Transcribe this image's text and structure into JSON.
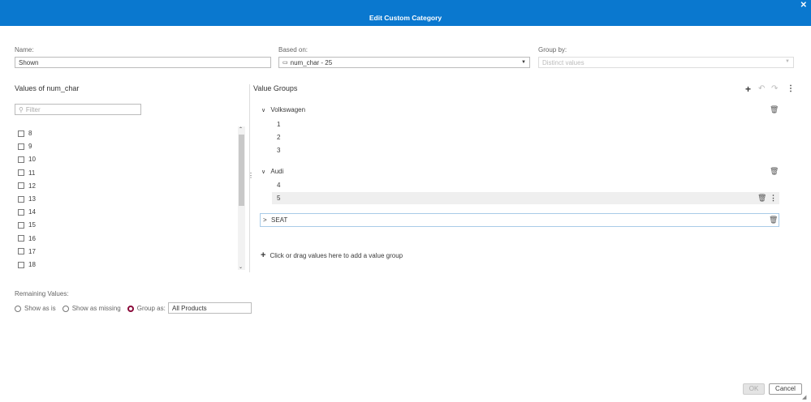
{
  "dialog": {
    "title": "Edit Custom Category",
    "close_icon": "close-icon"
  },
  "name": {
    "label": "Name:",
    "value": "Shown"
  },
  "based_on": {
    "label": "Based on:",
    "value": "num_char - 25",
    "icon": "data-item-icon"
  },
  "group_by": {
    "label": "Group by:",
    "placeholder": "Distinct values"
  },
  "values_panel": {
    "title": "Values of num_char",
    "filter_placeholder": "Filter",
    "items": [
      "8",
      "9",
      "10",
      "11",
      "12",
      "13",
      "14",
      "15",
      "16",
      "17",
      "18"
    ]
  },
  "groups_panel": {
    "title": "Value Groups",
    "groups": [
      {
        "name": "Volkswagen",
        "expanded": true,
        "values": [
          "1",
          "2",
          "3"
        ]
      },
      {
        "name": "Audi",
        "expanded": true,
        "values": [
          "4",
          "5"
        ]
      },
      {
        "name": "SEAT",
        "expanded": false,
        "values": []
      }
    ],
    "add_hint": "Click or drag values here to add a value group"
  },
  "remaining": {
    "label": "Remaining Values:",
    "options": [
      "Show as is",
      "Show as missing",
      "Group as:"
    ],
    "selected": "Group as:",
    "group_as_value": "All Products"
  },
  "footer": {
    "ok": "OK",
    "cancel": "Cancel"
  },
  "colors": {
    "header": "#0a78cf",
    "radio_selected": "#8a0a3a"
  }
}
